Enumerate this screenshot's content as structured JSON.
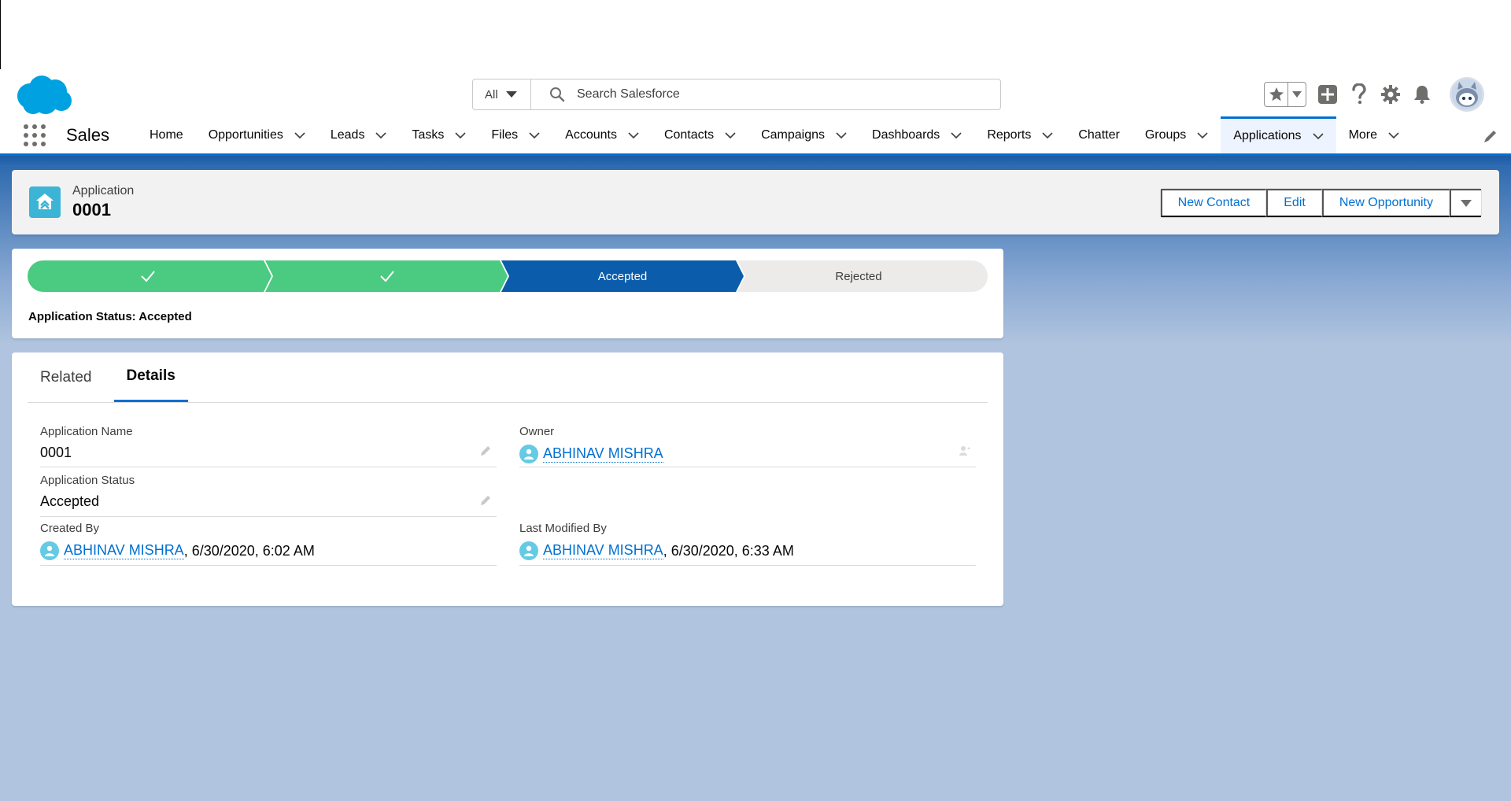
{
  "header": {
    "search_scope": "All",
    "search_placeholder": "Search Salesforce"
  },
  "nav": {
    "app_name": "Sales",
    "items": [
      {
        "label": "Home",
        "has_menu": false
      },
      {
        "label": "Opportunities",
        "has_menu": true
      },
      {
        "label": "Leads",
        "has_menu": true
      },
      {
        "label": "Tasks",
        "has_menu": true
      },
      {
        "label": "Files",
        "has_menu": true
      },
      {
        "label": "Accounts",
        "has_menu": true
      },
      {
        "label": "Contacts",
        "has_menu": true
      },
      {
        "label": "Campaigns",
        "has_menu": true
      },
      {
        "label": "Dashboards",
        "has_menu": true
      },
      {
        "label": "Reports",
        "has_menu": true
      },
      {
        "label": "Chatter",
        "has_menu": false
      },
      {
        "label": "Groups",
        "has_menu": true
      },
      {
        "label": "Applications",
        "has_menu": true,
        "active": true
      },
      {
        "label": "More",
        "has_menu": true
      }
    ]
  },
  "record": {
    "object_type": "Application",
    "title": "0001",
    "actions": [
      "New Contact",
      "Edit",
      "New Opportunity"
    ]
  },
  "path": {
    "steps": [
      {
        "label": "",
        "state": "complete"
      },
      {
        "label": "",
        "state": "complete"
      },
      {
        "label": "Accepted",
        "state": "current"
      },
      {
        "label": "Rejected",
        "state": "incomplete"
      }
    ],
    "status_text": "Application Status: Accepted"
  },
  "tabs": [
    "Related",
    "Details"
  ],
  "active_tab": "Details",
  "details": {
    "application_name_label": "Application Name",
    "application_name": "0001",
    "owner_label": "Owner",
    "owner": "ABHINAV MISHRA",
    "application_status_label": "Application Status",
    "application_status": "Accepted",
    "created_by_label": "Created By",
    "created_by_user": "ABHINAV MISHRA",
    "created_by_date": ", 6/30/2020, 6:02 AM",
    "last_modified_by_label": "Last Modified By",
    "last_modified_by_user": "ABHINAV MISHRA",
    "last_modified_by_date": ", 6/30/2020, 6:33 AM"
  },
  "colors": {
    "brand_blue": "#0070d2",
    "path_complete": "#4bca81",
    "path_current": "#0b5cab",
    "path_incomplete": "#ecebea",
    "record_icon": "#3cb4d6"
  }
}
